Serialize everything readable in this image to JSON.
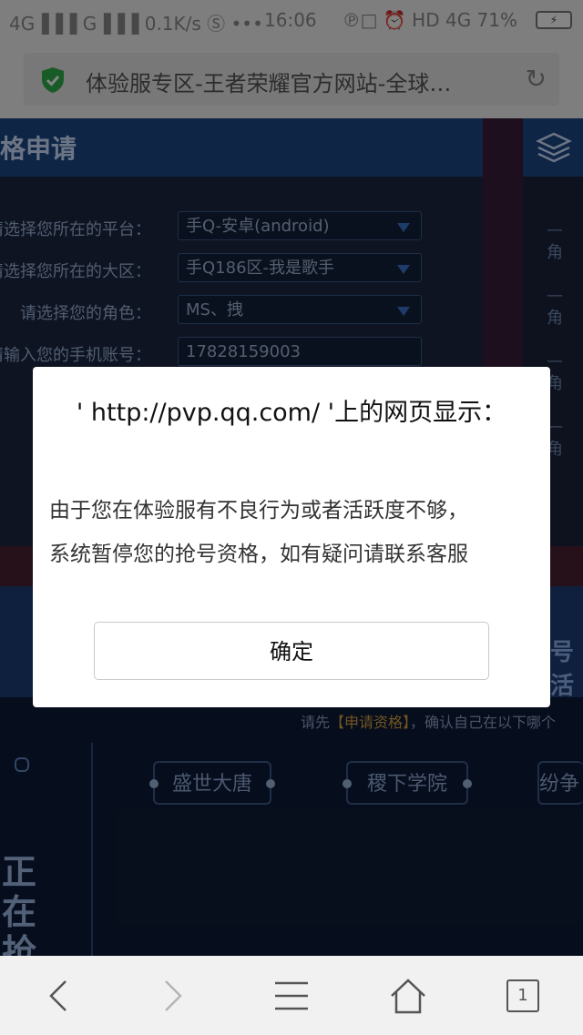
{
  "status_bar": {
    "left": "4G▐▐▐ G▐▐▐ 0.1K/s Ⓢ •••",
    "time": "16:06",
    "right": "℗□ ⏰ HD 4G 71%",
    "battery": "⚡"
  },
  "browser": {
    "url_title": "体验服专区-王者荣耀官方网站-全球…"
  },
  "page": {
    "section_title": "格申请",
    "form": [
      {
        "label": "请选择您所在的平台：",
        "value": "手Q-安卓(android)"
      },
      {
        "label": "请选择您所在的大区：",
        "value": "手Q186区-我是歌手"
      },
      {
        "label": "请选择您的角色：",
        "value": "MS、拽"
      },
      {
        "label": "请输入您的手机账号：",
        "value": "17828159003"
      }
    ],
    "right_list": [
      "— 角",
      "— 角",
      "— 角",
      "— 角"
    ],
    "band_text": "号活",
    "hint_prefix": "请先",
    "hint_link": "【申请资格】",
    "hint_suffix": "，确认自己在以下哪个",
    "tags": [
      "盛世大唐",
      "稷下学院",
      "纷争"
    ],
    "big_text": "正在抢"
  },
  "dialog": {
    "title": "' http://pvp.qq.com/ '上的网页显示：",
    "message_line1": "由于您在体验服有不良行为或者活跃度不够，",
    "message_line2": "系统暂停您的抢号资格，如有疑问请联系客服",
    "ok_button": "确定"
  },
  "bottom_nav": {
    "tabs_count": "1"
  }
}
